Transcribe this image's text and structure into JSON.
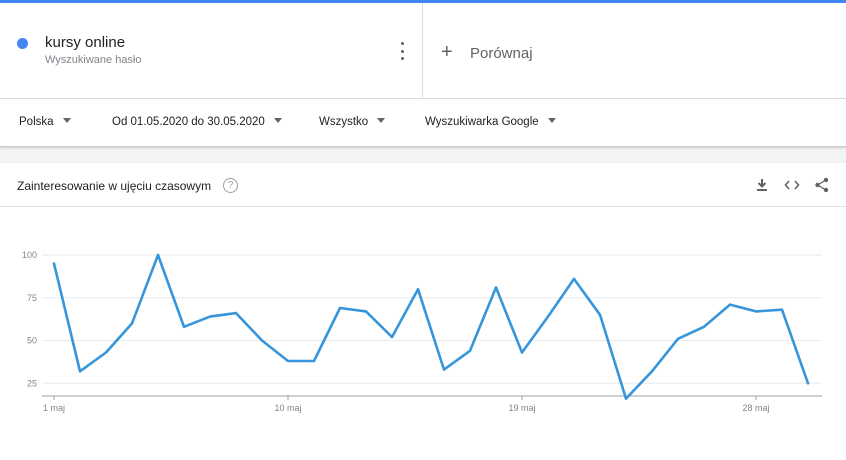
{
  "terms": [
    {
      "name": "kursy online",
      "subtitle": "Wyszukiwane hasło",
      "color": "#4285f4"
    }
  ],
  "compare_label": "Porównaj",
  "filters": {
    "region": "Polska",
    "date_range": "Od 01.05.2020 do 30.05.2020",
    "category": "Wszystko",
    "source": "Wyszukiwarka Google"
  },
  "card": {
    "title": "Zainteresowanie w ujęciu czasowym",
    "help_glyph": "?",
    "icons": [
      "download-icon",
      "embed-icon",
      "share-icon"
    ]
  },
  "chart_data": {
    "type": "line",
    "x": [
      "1 maj",
      "2 maj",
      "3 maj",
      "4 maj",
      "5 maj",
      "6 maj",
      "7 maj",
      "8 maj",
      "9 maj",
      "10 maj",
      "11 maj",
      "12 maj",
      "13 maj",
      "14 maj",
      "15 maj",
      "16 maj",
      "17 maj",
      "18 maj",
      "19 maj",
      "20 maj",
      "21 maj",
      "22 maj",
      "23 maj",
      "24 maj",
      "25 maj",
      "26 maj",
      "27 maj",
      "28 maj",
      "29 maj",
      "30 maj"
    ],
    "series": [
      {
        "values": [
          95,
          32,
          43,
          60,
          100,
          58,
          64,
          66,
          50,
          38,
          38,
          69,
          67,
          52,
          80,
          33,
          44,
          81,
          43,
          64,
          86,
          65,
          16,
          32,
          51,
          58,
          71,
          67,
          68,
          25
        ],
        "color": "#4285f4"
      }
    ],
    "x_tick_labels": [
      "1 maj",
      "10 maj",
      "19 maj",
      "28 maj"
    ],
    "x_tick_indices": [
      0,
      9,
      18,
      27
    ],
    "y_ticks": [
      25,
      50,
      75,
      100
    ],
    "ylim": [
      0,
      100
    ],
    "grid": true,
    "line_color": "#3796db"
  }
}
